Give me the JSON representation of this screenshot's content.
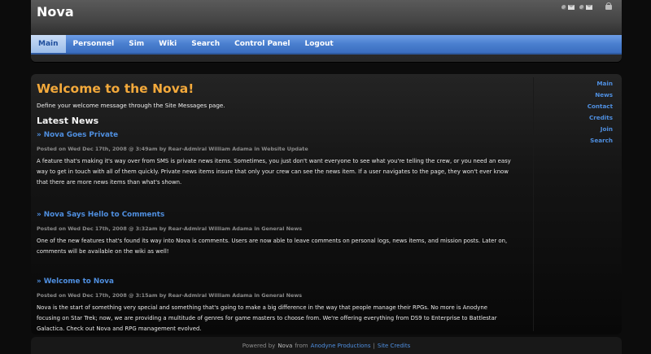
{
  "header": {
    "brand": "Nova",
    "nav": [
      "Main",
      "Personnel",
      "Sim",
      "Wiki",
      "Search",
      "Control Panel",
      "Logout"
    ],
    "active_nav": "Main"
  },
  "main": {
    "welcome_title": "Welcome to the Nova!",
    "welcome_text": "Define your welcome message through the Site Messages page.",
    "latest_heading": "Latest News",
    "news": [
      {
        "title": "» Nova Goes Private",
        "meta": "Posted on Wed Dec 17th, 2008 @ 3:49am by Rear-Admiral William Adama in Website Update",
        "body": "A feature that's making it's way over from SMS is private news items. Sometimes, you just don't want everyone to see what you're telling the crew, or you need an easy way to get in touch with all of them quickly. Private news items insure that only your crew can see the news item. If a user navigates to the page, they won't ever know that there are more news items than what's shown."
      },
      {
        "title": "» Nova Says Hello to Comments",
        "meta": "Posted on Wed Dec 17th, 2008 @ 3:32am by Rear-Admiral William Adama in General News",
        "body": "One of the new features that's found its way into Nova is comments. Users are now able to leave comments on personal logs, news items, and mission posts. Later on, comments will be available on the wiki as well!"
      },
      {
        "title": "» Welcome to Nova",
        "meta": "Posted on Wed Dec 17th, 2008 @ 3:15am by Rear-Admiral William Adama in General News",
        "body": "Nova is the start of something very special and something that's going to make a big difference in the way that people manage their RPGs. No more is Anodyne focusing on Star Trek; now, we are providing a multitude of genres for game masters to choose from. We're offering everything from DS9 to Enterprise to Battlestar Galactica. Check out Nova and RPG management evolved."
      }
    ]
  },
  "sidebar": {
    "links": [
      "Main",
      "News",
      "Contact",
      "Credits",
      "Join",
      "Search"
    ]
  },
  "footer": {
    "powered_by": "Powered by",
    "brand": "Nova",
    "from": "from",
    "company_link": "Anodyne Productions",
    "separator": "|",
    "credits_link": "Site Credits"
  },
  "colors": {
    "accent_blue": "#4f8fe0",
    "welcome_orange": "#f3a93b",
    "nav_blue": "#4a7fcf",
    "background": "#0c0c0c"
  }
}
